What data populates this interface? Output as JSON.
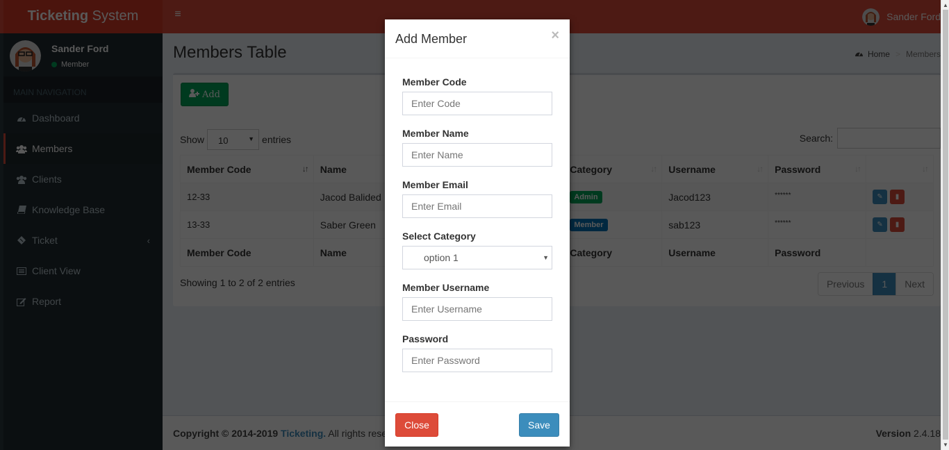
{
  "app": {
    "title_bold": "Ticketing",
    "title_rest": " System"
  },
  "header": {
    "user_name": "Sander Ford",
    "menu_toggle_icon": "hamburger-icon"
  },
  "sidebar": {
    "user": {
      "name": "Sander Ford",
      "status": "Member"
    },
    "nav_header": "MAIN NAVIGATION",
    "items": [
      {
        "label": "Dashboard",
        "icon": "dashboard-icon"
      },
      {
        "label": "Members",
        "icon": "users-icon",
        "active": true
      },
      {
        "label": "Clients",
        "icon": "users-icon"
      },
      {
        "label": "Knowledge Base",
        "icon": "book-icon"
      },
      {
        "label": "Ticket",
        "icon": "ticket-icon",
        "chevron": "‹"
      },
      {
        "label": "Client View",
        "icon": "list-icon"
      },
      {
        "label": "Report",
        "icon": "edit-icon"
      }
    ]
  },
  "page": {
    "title": "Members Table",
    "breadcrumb": {
      "home": "Home",
      "current": "Members",
      "sep": ">"
    }
  },
  "table_controls": {
    "add_label": "Add",
    "show_label": "Show",
    "entries_value": "10",
    "entries_label": "entries",
    "search_label": "Search:",
    "search_value": ""
  },
  "table": {
    "columns": [
      "Member Code",
      "Name",
      "Category",
      "Username",
      "Password",
      ""
    ],
    "rows": [
      {
        "code": "12-33",
        "name": "Jacod Balided",
        "category": "Admin",
        "category_color": "#00a65a",
        "username": "Jacod123",
        "password": "******"
      },
      {
        "code": "13-33",
        "name": "Saber Green",
        "category": "Member",
        "category_color": "#0073b7",
        "username": "sab123",
        "password": "******"
      }
    ],
    "info": "Showing 1 to 2 of 2 entries",
    "pager": {
      "prev": "Previous",
      "current": "1",
      "next": "Next"
    }
  },
  "footer": {
    "copyright": "Copyright © 2014-2019 ",
    "brand": "Ticketing.",
    "rights": " All rights reserved.",
    "version_label": "Version",
    "version": " 2.4.18"
  },
  "modal": {
    "title": "Add Member",
    "close_glyph": "×",
    "fields": [
      {
        "label": "Member Code",
        "placeholder": "Enter Code"
      },
      {
        "label": "Member Name",
        "placeholder": "Enter Name"
      },
      {
        "label": "Member Email",
        "placeholder": "Enter Email"
      },
      {
        "label": "Select Category",
        "value": "option 1"
      },
      {
        "label": "Member Username",
        "placeholder": "Enter Username"
      },
      {
        "label": "Password",
        "placeholder": "Enter Password"
      }
    ],
    "close_label": "Close",
    "save_label": "Save"
  },
  "colors": {
    "header": "#dd4b39",
    "sidebar": "#222d32",
    "primary": "#3c8dbc",
    "success": "#00a65a",
    "danger": "#dd4b39"
  }
}
